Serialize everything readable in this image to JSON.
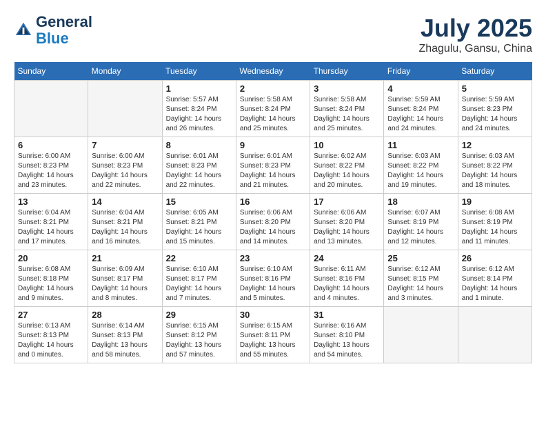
{
  "header": {
    "logo_line1": "General",
    "logo_line2": "Blue",
    "month_title": "July 2025",
    "location": "Zhagulu, Gansu, China"
  },
  "days_of_week": [
    "Sunday",
    "Monday",
    "Tuesday",
    "Wednesday",
    "Thursday",
    "Friday",
    "Saturday"
  ],
  "weeks": [
    [
      {
        "day": "",
        "info": ""
      },
      {
        "day": "",
        "info": ""
      },
      {
        "day": "1",
        "info": "Sunrise: 5:57 AM\nSunset: 8:24 PM\nDaylight: 14 hours\nand 26 minutes."
      },
      {
        "day": "2",
        "info": "Sunrise: 5:58 AM\nSunset: 8:24 PM\nDaylight: 14 hours\nand 25 minutes."
      },
      {
        "day": "3",
        "info": "Sunrise: 5:58 AM\nSunset: 8:24 PM\nDaylight: 14 hours\nand 25 minutes."
      },
      {
        "day": "4",
        "info": "Sunrise: 5:59 AM\nSunset: 8:24 PM\nDaylight: 14 hours\nand 24 minutes."
      },
      {
        "day": "5",
        "info": "Sunrise: 5:59 AM\nSunset: 8:23 PM\nDaylight: 14 hours\nand 24 minutes."
      }
    ],
    [
      {
        "day": "6",
        "info": "Sunrise: 6:00 AM\nSunset: 8:23 PM\nDaylight: 14 hours\nand 23 minutes."
      },
      {
        "day": "7",
        "info": "Sunrise: 6:00 AM\nSunset: 8:23 PM\nDaylight: 14 hours\nand 22 minutes."
      },
      {
        "day": "8",
        "info": "Sunrise: 6:01 AM\nSunset: 8:23 PM\nDaylight: 14 hours\nand 22 minutes."
      },
      {
        "day": "9",
        "info": "Sunrise: 6:01 AM\nSunset: 8:23 PM\nDaylight: 14 hours\nand 21 minutes."
      },
      {
        "day": "10",
        "info": "Sunrise: 6:02 AM\nSunset: 8:22 PM\nDaylight: 14 hours\nand 20 minutes."
      },
      {
        "day": "11",
        "info": "Sunrise: 6:03 AM\nSunset: 8:22 PM\nDaylight: 14 hours\nand 19 minutes."
      },
      {
        "day": "12",
        "info": "Sunrise: 6:03 AM\nSunset: 8:22 PM\nDaylight: 14 hours\nand 18 minutes."
      }
    ],
    [
      {
        "day": "13",
        "info": "Sunrise: 6:04 AM\nSunset: 8:21 PM\nDaylight: 14 hours\nand 17 minutes."
      },
      {
        "day": "14",
        "info": "Sunrise: 6:04 AM\nSunset: 8:21 PM\nDaylight: 14 hours\nand 16 minutes."
      },
      {
        "day": "15",
        "info": "Sunrise: 6:05 AM\nSunset: 8:21 PM\nDaylight: 14 hours\nand 15 minutes."
      },
      {
        "day": "16",
        "info": "Sunrise: 6:06 AM\nSunset: 8:20 PM\nDaylight: 14 hours\nand 14 minutes."
      },
      {
        "day": "17",
        "info": "Sunrise: 6:06 AM\nSunset: 8:20 PM\nDaylight: 14 hours\nand 13 minutes."
      },
      {
        "day": "18",
        "info": "Sunrise: 6:07 AM\nSunset: 8:19 PM\nDaylight: 14 hours\nand 12 minutes."
      },
      {
        "day": "19",
        "info": "Sunrise: 6:08 AM\nSunset: 8:19 PM\nDaylight: 14 hours\nand 11 minutes."
      }
    ],
    [
      {
        "day": "20",
        "info": "Sunrise: 6:08 AM\nSunset: 8:18 PM\nDaylight: 14 hours\nand 9 minutes."
      },
      {
        "day": "21",
        "info": "Sunrise: 6:09 AM\nSunset: 8:17 PM\nDaylight: 14 hours\nand 8 minutes."
      },
      {
        "day": "22",
        "info": "Sunrise: 6:10 AM\nSunset: 8:17 PM\nDaylight: 14 hours\nand 7 minutes."
      },
      {
        "day": "23",
        "info": "Sunrise: 6:10 AM\nSunset: 8:16 PM\nDaylight: 14 hours\nand 5 minutes."
      },
      {
        "day": "24",
        "info": "Sunrise: 6:11 AM\nSunset: 8:16 PM\nDaylight: 14 hours\nand 4 minutes."
      },
      {
        "day": "25",
        "info": "Sunrise: 6:12 AM\nSunset: 8:15 PM\nDaylight: 14 hours\nand 3 minutes."
      },
      {
        "day": "26",
        "info": "Sunrise: 6:12 AM\nSunset: 8:14 PM\nDaylight: 14 hours\nand 1 minute."
      }
    ],
    [
      {
        "day": "27",
        "info": "Sunrise: 6:13 AM\nSunset: 8:13 PM\nDaylight: 14 hours\nand 0 minutes."
      },
      {
        "day": "28",
        "info": "Sunrise: 6:14 AM\nSunset: 8:13 PM\nDaylight: 13 hours\nand 58 minutes."
      },
      {
        "day": "29",
        "info": "Sunrise: 6:15 AM\nSunset: 8:12 PM\nDaylight: 13 hours\nand 57 minutes."
      },
      {
        "day": "30",
        "info": "Sunrise: 6:15 AM\nSunset: 8:11 PM\nDaylight: 13 hours\nand 55 minutes."
      },
      {
        "day": "31",
        "info": "Sunrise: 6:16 AM\nSunset: 8:10 PM\nDaylight: 13 hours\nand 54 minutes."
      },
      {
        "day": "",
        "info": ""
      },
      {
        "day": "",
        "info": ""
      }
    ]
  ]
}
